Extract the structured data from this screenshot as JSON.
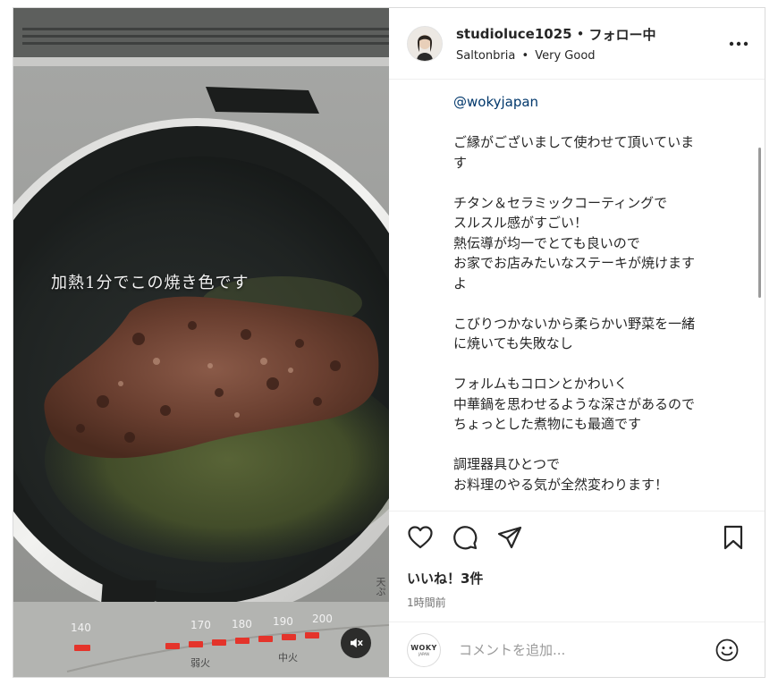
{
  "post": {
    "media": {
      "overlay_caption": "加熱1分でこの焼き色です",
      "dial_ticks": [
        "140",
        "170",
        "180",
        "190",
        "200"
      ],
      "dial_low_label": "弱火",
      "dial_mid_label": "中火",
      "corner_label": "天ぷ",
      "mute_icon": "speaker-muted-icon"
    },
    "header": {
      "username": "studioluce1025",
      "separator": "•",
      "follow_status": "フォロー中",
      "location": "Saltonbria",
      "location_separator": "•",
      "audio": "Very Good",
      "more_icon": "more-horizontal-icon"
    },
    "caption": {
      "mention": "@wokyjapan",
      "paragraphs": [
        [
          "ご縁がございまして使わせて頂いていま",
          "す"
        ],
        [
          "チタン＆セラミックコーティングで",
          "スルスル感がすごい！",
          "熱伝導が均一でとても良いので",
          "お家でお店みたいなステーキが焼けます",
          "よ"
        ],
        [
          "こびりつかないから柔らかい野菜を一緒",
          "に焼いても失敗なし"
        ],
        [
          "フォルムもコロンとかわいく",
          "中華鍋を思わせるような深さがあるので",
          "ちょっとした煮物にも最適です"
        ],
        [
          "調理器具ひとつで",
          "お料理のやる気が全然変わります！"
        ]
      ]
    },
    "actions": {
      "like_icon": "heart-icon",
      "comment_icon": "comment-bubble-icon",
      "share_icon": "paper-plane-icon",
      "save_icon": "bookmark-icon"
    },
    "likes": "いいね！3件",
    "timestamp": "1時間前",
    "comment_box": {
      "avatar_brand": "WOKY",
      "avatar_brand_sub": "JAPAN",
      "placeholder": "コメントを追加...",
      "emoji_icon": "smiley-face-icon"
    }
  }
}
